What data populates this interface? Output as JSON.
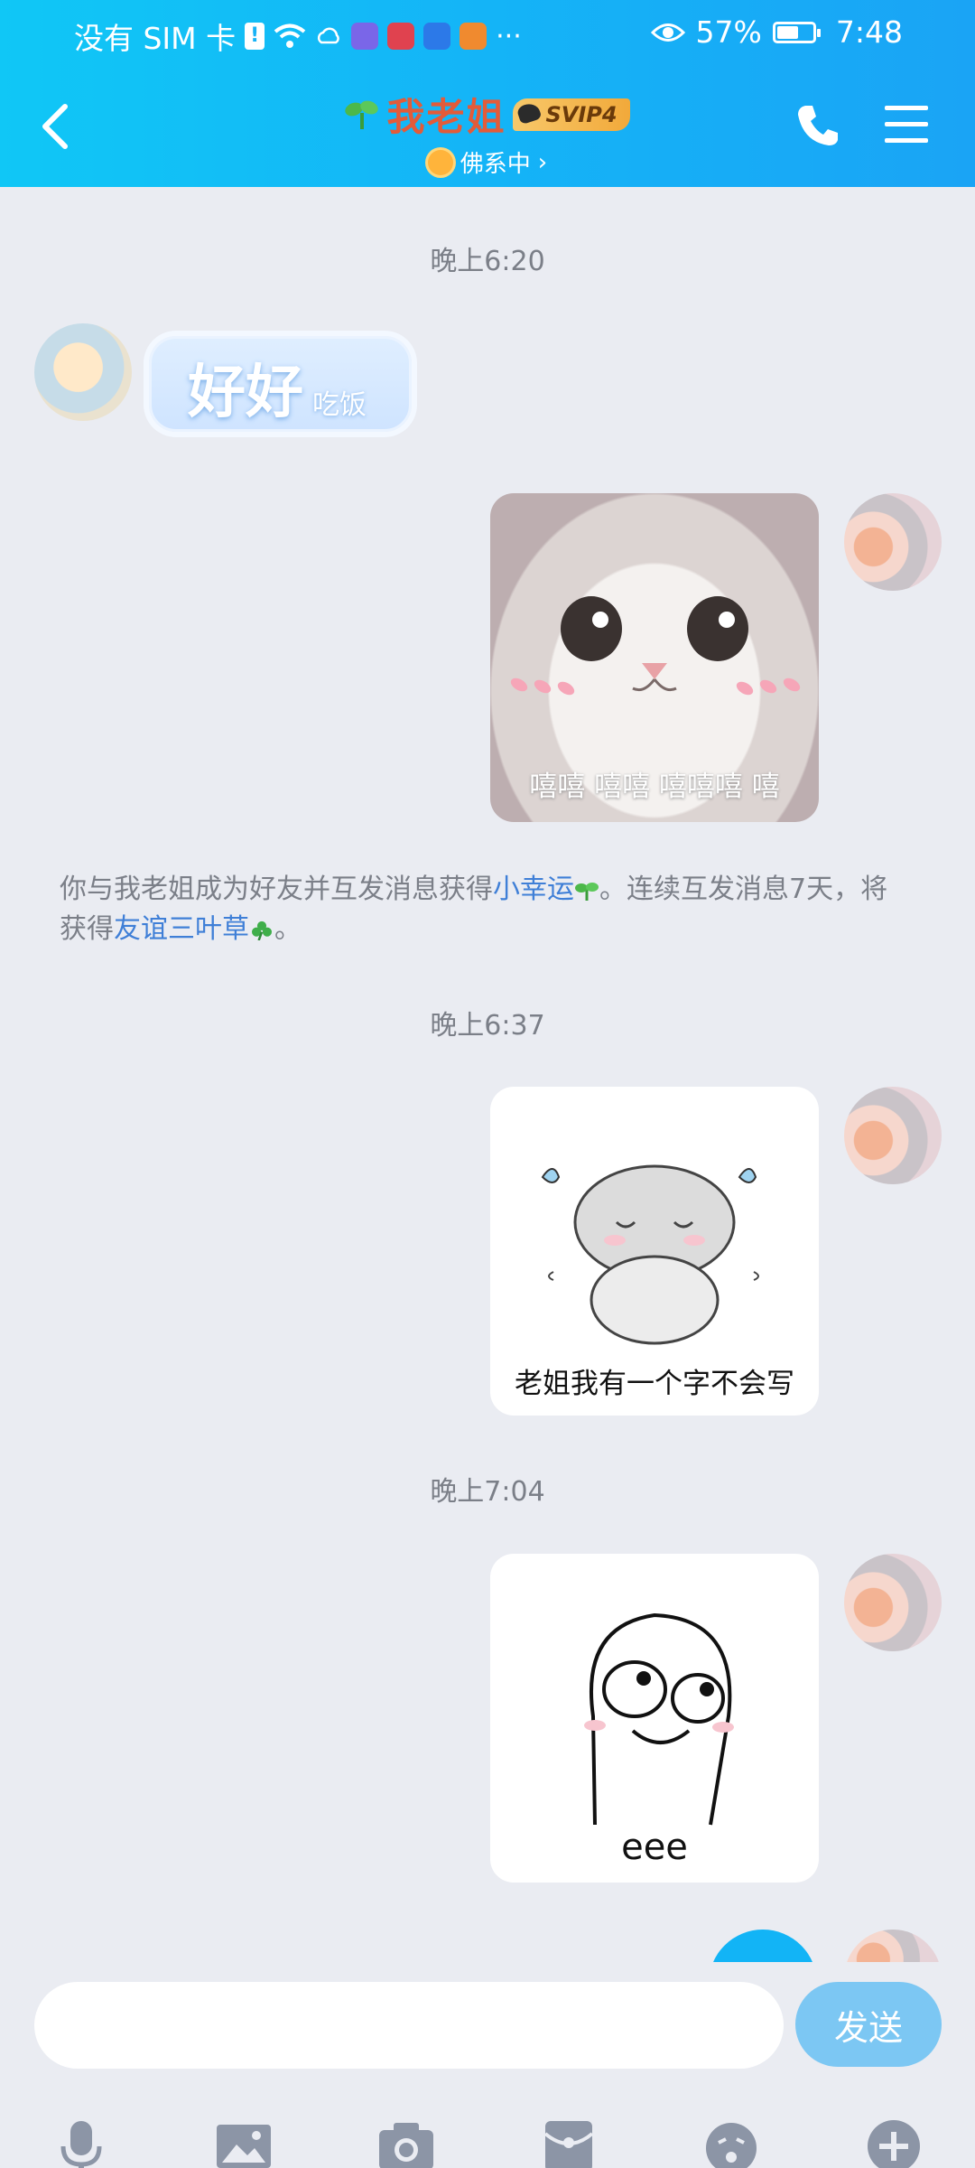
{
  "status_bar": {
    "carrier": "没有 SIM 卡",
    "more": "···",
    "battery": "57%",
    "time": "7:48"
  },
  "header": {
    "title": "我老姐",
    "vip_badge": "SVIP4",
    "status": "佛系中",
    "status_chevron": "›"
  },
  "messages": {
    "time1": "晚上6:20",
    "text_bubble_main": "好好",
    "text_bubble_small": "吃饭",
    "sticker1_caption": "嘻嘻 嘻嘻 嘻嘻嘻 嘻",
    "system_note": {
      "part1": "你与我老姐成为好友并互发消息获得",
      "link1": "小幸运",
      "part2": "。连续互发消息7天，将获得",
      "link2": "友谊三叶草",
      "part3": "。"
    },
    "time2": "晚上6:37",
    "sticker2_caption": "老姐我有一个字不会写",
    "time3": "晚上7:04",
    "sticker3_caption": "eee"
  },
  "composer": {
    "input_value": "",
    "send_label": "发送"
  },
  "colors": {
    "header_start": "#10c7f6",
    "header_end": "#1aa4f5",
    "title": "#e35b39",
    "link": "#3f7fd7",
    "send_button": "#7cc7f3",
    "chat_bg": "#eaecf2"
  },
  "icons": [
    "back-arrow-icon",
    "phone-icon",
    "menu-icon",
    "microphone-icon",
    "image-icon",
    "camera-icon",
    "red-packet-icon",
    "emoji-icon",
    "plus-icon"
  ]
}
